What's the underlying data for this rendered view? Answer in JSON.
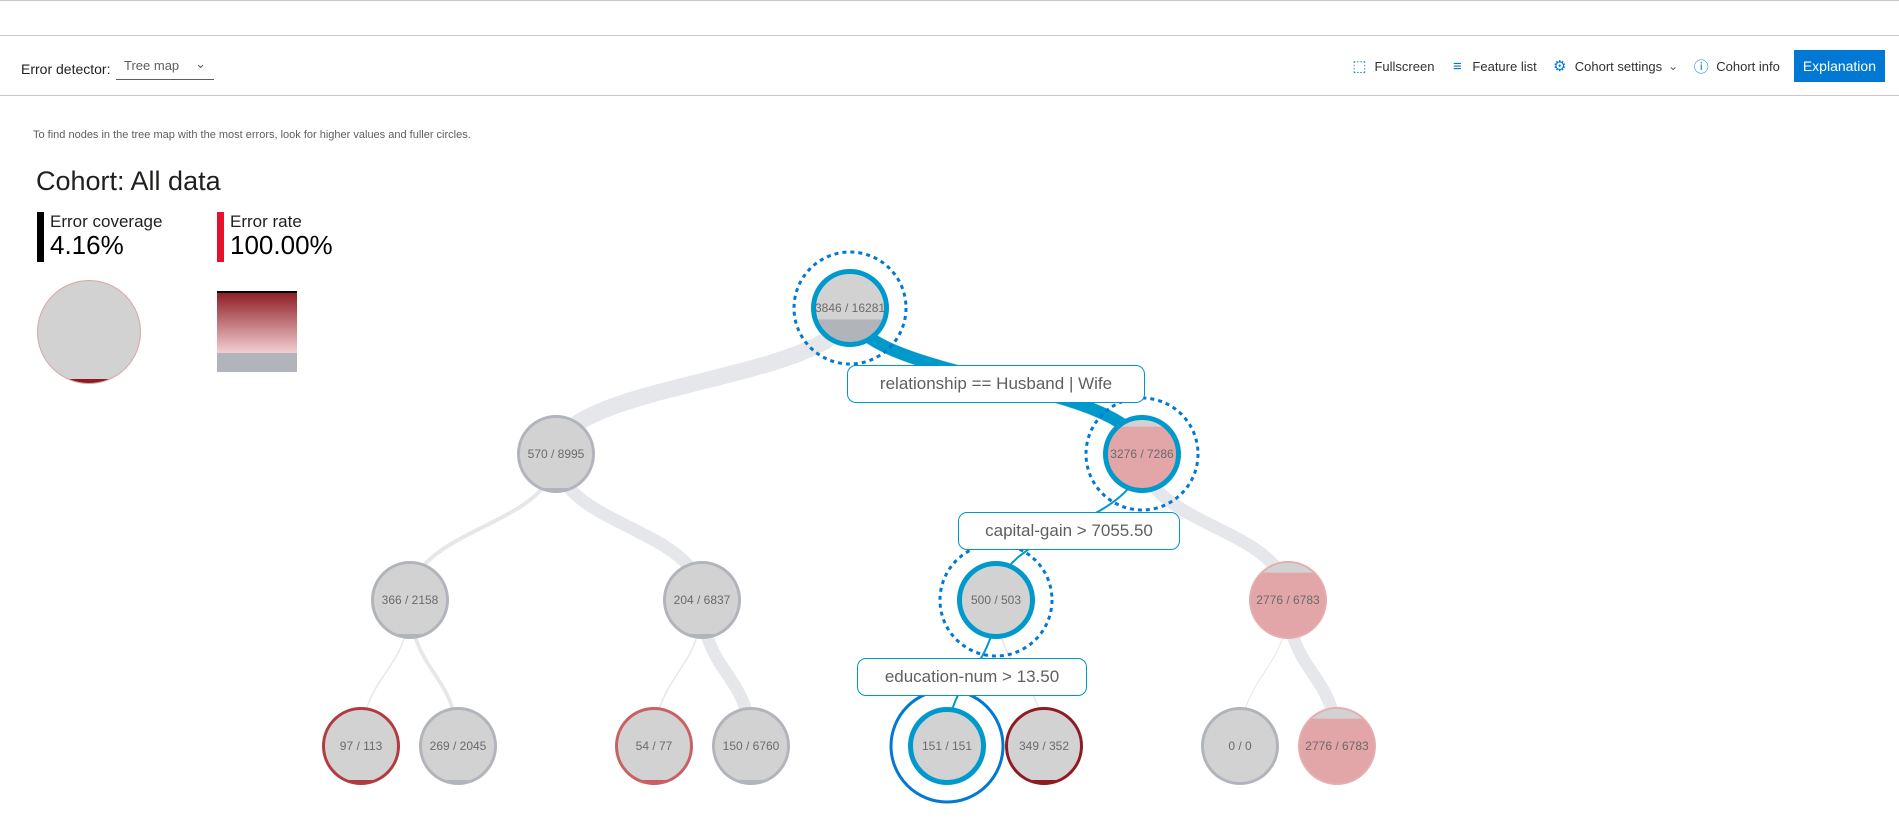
{
  "toolbar": {
    "detector_label": "Error detector:",
    "detector_value": "Tree map",
    "fullscreen": "Fullscreen",
    "feature_list": "Feature list",
    "cohort_settings": "Cohort settings",
    "cohort_info": "Cohort info",
    "explanation": "Explanation"
  },
  "hint": "To find nodes in the tree map with the most errors, look for higher values and fuller circles.",
  "cohort": {
    "title": "Cohort: All data",
    "error_coverage_label": "Error coverage",
    "error_coverage_value": "4.16%",
    "error_rate_label": "Error rate",
    "error_rate_value": "100.00%",
    "legend_coverage_fraction": 0.04,
    "coverage_color": "#000000",
    "rate_color": "#e8112d"
  },
  "colors": {
    "accent": "#0078d4",
    "selected_path": "#0099cc",
    "dark_red": "#8e1b22",
    "light_red": "#e2a5a8",
    "gray": "#d2d2d2",
    "gray_border": "#b1b5bb",
    "link": "#e6e7ea"
  },
  "tree": {
    "nodes": [
      {
        "id": "n0",
        "label": "3846 / 16281",
        "errors": 3846,
        "total": 16281,
        "parent": null,
        "depth": 0,
        "slot": 0,
        "state": "selected-path",
        "fill": "gray",
        "ring": "dashed"
      },
      {
        "id": "n1",
        "label": "570 / 8995",
        "errors": 570,
        "total": 8995,
        "parent": "n0",
        "depth": 1,
        "slot": 0,
        "state": "normal",
        "fill": "gray"
      },
      {
        "id": "n2",
        "label": "3276 / 7286",
        "errors": 3276,
        "total": 7286,
        "parent": "n0",
        "depth": 1,
        "slot": 1,
        "state": "selected-path",
        "fill": "pink",
        "ring": "dashed"
      },
      {
        "id": "n3",
        "label": "366 / 2158",
        "errors": 366,
        "total": 2158,
        "parent": "n1",
        "depth": 2,
        "slot": 0,
        "state": "normal",
        "fill": "gray"
      },
      {
        "id": "n4",
        "label": "204 / 6837",
        "errors": 204,
        "total": 6837,
        "parent": "n1",
        "depth": 2,
        "slot": 1,
        "state": "normal",
        "fill": "gray"
      },
      {
        "id": "n5",
        "label": "500 / 503",
        "errors": 500,
        "total": 503,
        "parent": "n2",
        "depth": 2,
        "slot": 2,
        "state": "selected-path",
        "fill": "gray",
        "ring": "dashed"
      },
      {
        "id": "n6",
        "label": "2776 / 6783",
        "errors": 2776,
        "total": 6783,
        "parent": "n2",
        "depth": 2,
        "slot": 3,
        "state": "normal",
        "fill": "pink"
      },
      {
        "id": "n7",
        "label": "97 / 113",
        "errors": 97,
        "total": 113,
        "parent": "n3",
        "depth": 3,
        "slot": 0,
        "state": "normal",
        "fill": "gray",
        "border": "red"
      },
      {
        "id": "n8",
        "label": "269 / 2045",
        "errors": 269,
        "total": 2045,
        "parent": "n3",
        "depth": 3,
        "slot": 1,
        "state": "normal",
        "fill": "gray"
      },
      {
        "id": "n9",
        "label": "54 / 77",
        "errors": 54,
        "total": 77,
        "parent": "n4",
        "depth": 3,
        "slot": 2,
        "state": "normal",
        "fill": "gray",
        "border": "lightred"
      },
      {
        "id": "n10",
        "label": "150 / 6760",
        "errors": 150,
        "total": 6760,
        "parent": "n4",
        "depth": 3,
        "slot": 3,
        "state": "normal",
        "fill": "gray"
      },
      {
        "id": "n11",
        "label": "151 / 151",
        "errors": 151,
        "total": 151,
        "parent": "n5",
        "depth": 3,
        "slot": 4,
        "state": "selected",
        "fill": "gray",
        "ring": "solid"
      },
      {
        "id": "n12",
        "label": "349 / 352",
        "errors": 349,
        "total": 352,
        "parent": "n5",
        "depth": 3,
        "slot": 5,
        "state": "normal",
        "fill": "gray",
        "border": "darkred"
      },
      {
        "id": "n13",
        "label": "0 / 0",
        "errors": 0,
        "total": 0,
        "parent": "n6",
        "depth": 3,
        "slot": 6,
        "state": "normal",
        "fill": "gray"
      },
      {
        "id": "n14",
        "label": "2776 / 6783",
        "errors": 2776,
        "total": 6783,
        "parent": "n6",
        "depth": 3,
        "slot": 7,
        "state": "normal",
        "fill": "pink"
      }
    ],
    "conditions": [
      {
        "label": "relationship == Husband | Wife",
        "between": [
          "n0",
          "n2"
        ]
      },
      {
        "label": "capital-gain > 7055.50",
        "between": [
          "n2",
          "n5"
        ]
      },
      {
        "label": "education-num > 13.50",
        "between": [
          "n5",
          "n11"
        ]
      }
    ]
  }
}
